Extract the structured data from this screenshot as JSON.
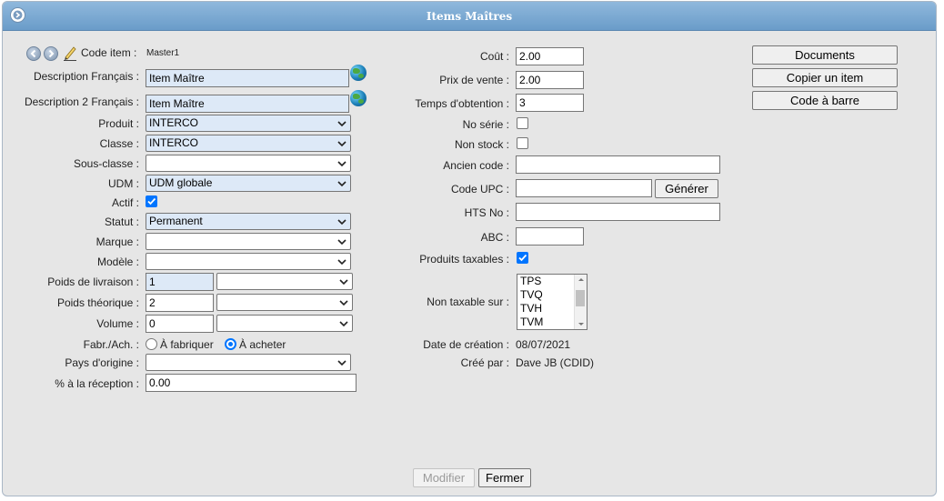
{
  "window": {
    "title": "Items Maîtres"
  },
  "left": {
    "code_item": {
      "label": "Code item :",
      "value": "Master1"
    },
    "description": {
      "label": "Description Français :",
      "value": "Item Maître"
    },
    "description2": {
      "label": "Description 2 Français :",
      "value": "Item Maître"
    },
    "produit": {
      "label": "Produit :",
      "value": "INTERCO"
    },
    "classe": {
      "label": "Classe :",
      "value": "INTERCO"
    },
    "sous_classe": {
      "label": "Sous-classe :",
      "value": ""
    },
    "udm": {
      "label": "UDM :",
      "value": "UDM globale"
    },
    "actif": {
      "label": "Actif :",
      "checked": true
    },
    "statut": {
      "label": "Statut :",
      "value": "Permanent"
    },
    "marque": {
      "label": "Marque :",
      "value": ""
    },
    "modele": {
      "label": "Modèle :",
      "value": ""
    },
    "poids_livraison": {
      "label": "Poids de livraison :",
      "value": "1",
      "unit": ""
    },
    "poids_theorique": {
      "label": "Poids théorique :",
      "value": "2",
      "unit": ""
    },
    "volume": {
      "label": "Volume :",
      "value": "0",
      "unit": ""
    },
    "fabr_ach": {
      "label": "Fabr./Ach. :",
      "opt1": "À fabriquer",
      "opt2": "À acheter",
      "selected": "À acheter"
    },
    "pays": {
      "label": "Pays d'origine :",
      "value": ""
    },
    "pct_reception": {
      "label": "% à la réception :",
      "value": "0.00"
    }
  },
  "middle": {
    "cout": {
      "label": "Coût :",
      "value": "2.00"
    },
    "prix_vente": {
      "label": "Prix de vente :",
      "value": "2.00"
    },
    "temps": {
      "label": "Temps d'obtention :",
      "value": "3"
    },
    "no_serie": {
      "label": "No série :",
      "checked": false
    },
    "non_stock": {
      "label": "Non stock :",
      "checked": false
    },
    "ancien_code": {
      "label": "Ancien code :",
      "value": ""
    },
    "code_upc": {
      "label": "Code UPC :",
      "value": "",
      "button": "Générer"
    },
    "hts_no": {
      "label": "HTS No :",
      "value": ""
    },
    "abc": {
      "label": "ABC :",
      "value": ""
    },
    "produits_taxables": {
      "label": "Produits taxables :",
      "checked": true
    },
    "non_taxable": {
      "label": "Non taxable sur :",
      "options": [
        "TPS",
        "TVQ",
        "TVH",
        "TVM"
      ]
    },
    "date_creation": {
      "label": "Date de création :",
      "value": "08/07/2021"
    },
    "cree_par": {
      "label": "Créé par :",
      "value": "Dave JB (CDID)"
    }
  },
  "right": {
    "documents": "Documents",
    "copier": "Copier un item",
    "code_barre": "Code à barre"
  },
  "footer": {
    "modifier": "Modifier",
    "fermer": "Fermer"
  },
  "colors": {
    "titlebar": "#6a9cc9",
    "highlight_field": "#dde9f7",
    "accent": "#0075ff"
  }
}
